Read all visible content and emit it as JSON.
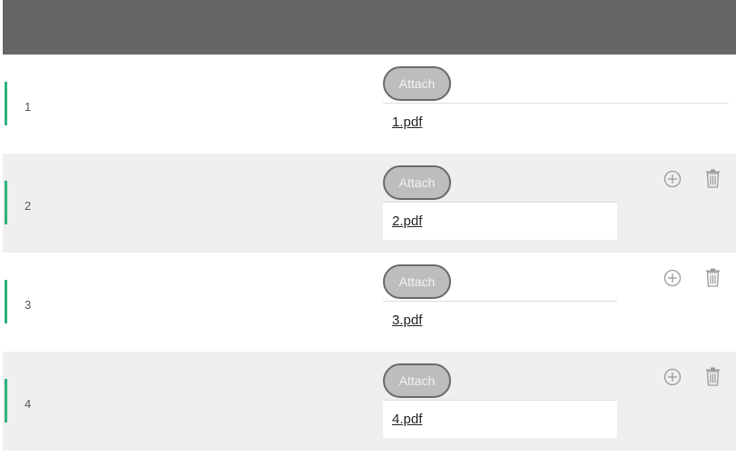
{
  "rows": [
    {
      "number": "1",
      "attach_label": "Attach",
      "file": "1.pdf",
      "add_icon": "add-circle-icon",
      "delete_icon": null
    },
    {
      "number": "2",
      "attach_label": "Attach",
      "file": "2.pdf",
      "add_icon": "add-circle-icon",
      "delete_icon": "trash-icon"
    },
    {
      "number": "3",
      "attach_label": "Attach",
      "file": "3.pdf",
      "add_icon": "add-circle-icon",
      "delete_icon": "trash-icon"
    },
    {
      "number": "4",
      "attach_label": "Attach",
      "file": "4.pdf",
      "add_icon": "add-circle-icon",
      "delete_icon": "trash-icon"
    }
  ],
  "colors": {
    "header": "#666666",
    "accent": "#2db37d",
    "row_alt": "#efefef",
    "button_fill": "#bdbdbd",
    "button_border": "#6a6a6a"
  }
}
